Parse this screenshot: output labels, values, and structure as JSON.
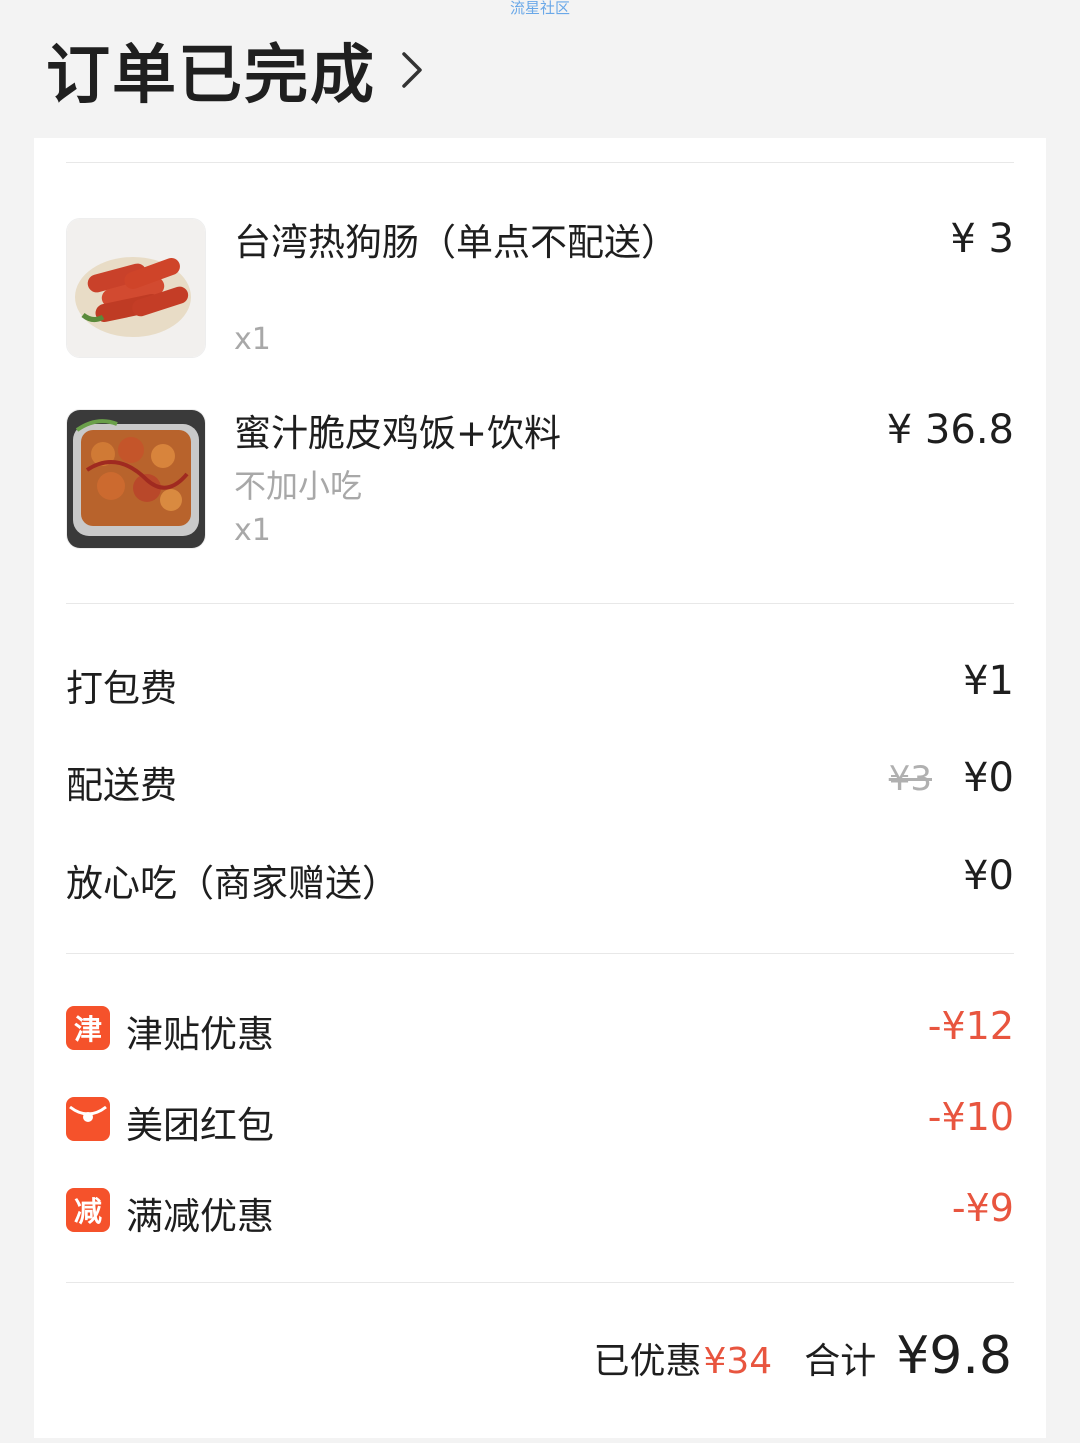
{
  "watermark": "流星社区",
  "header": {
    "title": "订单已完成"
  },
  "items": [
    {
      "name": "台湾热狗肠（单点不配送）",
      "spec": "",
      "qty": "x1",
      "price": "¥ 3"
    },
    {
      "name": "蜜汁脆皮鸡饭+饮料",
      "spec": "不加小吃",
      "qty": "x1",
      "price": "¥ 36.8"
    }
  ],
  "fees": [
    {
      "label": "打包费",
      "value": "¥1",
      "original": ""
    },
    {
      "label": "配送费",
      "value": "¥0",
      "original": "¥3"
    },
    {
      "label": "放心吃（商家赠送）",
      "value": "¥0",
      "original": ""
    }
  ],
  "discounts": [
    {
      "badge": "津",
      "label": "津贴优惠",
      "value": "-¥12",
      "icon": "jin-badge-icon"
    },
    {
      "badge": "",
      "label": "美团红包",
      "value": "-¥10",
      "icon": "red-packet-icon"
    },
    {
      "badge": "减",
      "label": "满减优惠",
      "value": "-¥9",
      "icon": "jian-badge-icon"
    }
  ],
  "summary": {
    "saved_label": "已优惠",
    "saved_value": "¥34",
    "total_label": "合计",
    "total_value": "¥9.8"
  },
  "colors": {
    "accent": "#e8553f",
    "badge": "#f5522b"
  }
}
